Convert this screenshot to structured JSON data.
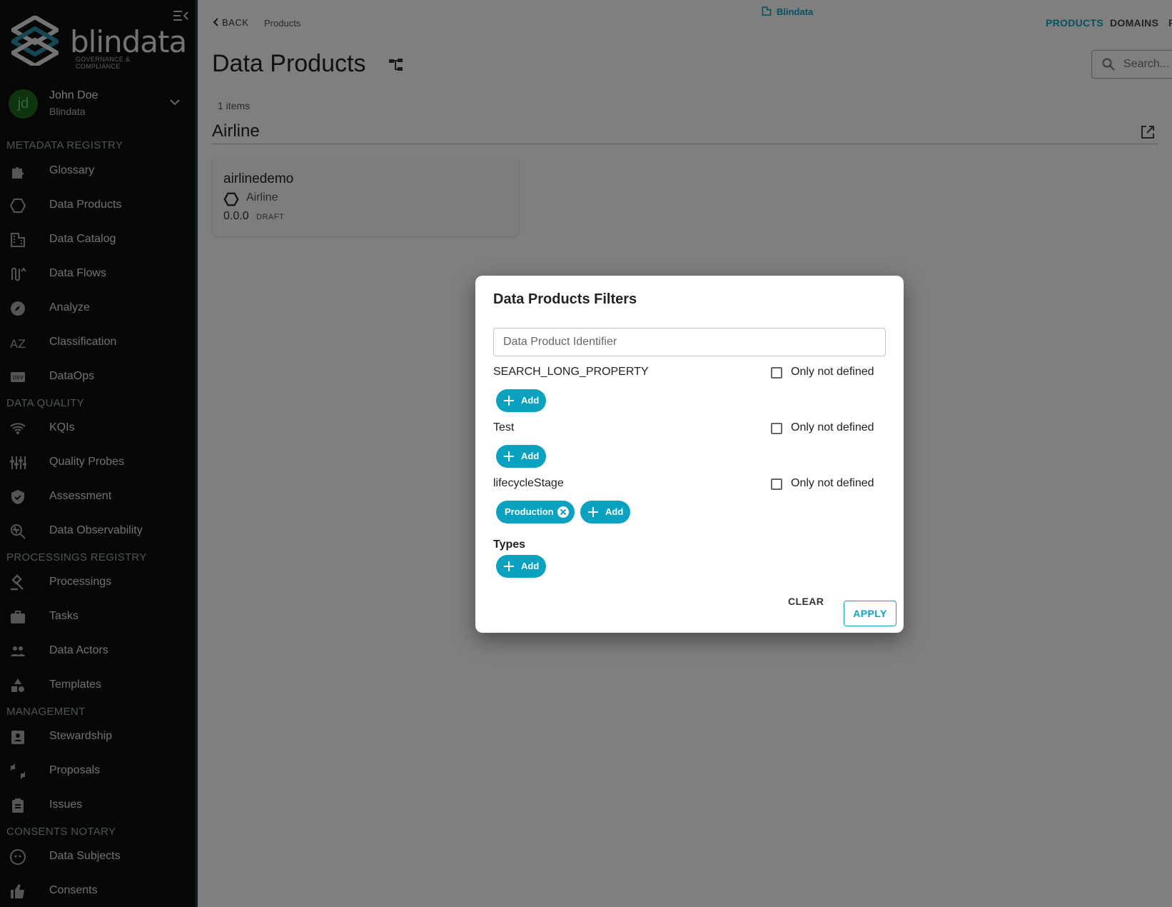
{
  "app": {
    "brand": "blindata",
    "tagline": "GOVERNANCE & COMPLIANCE",
    "accent_color": "#0aa2c0"
  },
  "user": {
    "initials": "jd",
    "name": "John Doe",
    "org": "Blindata"
  },
  "sidebar": {
    "sections": [
      {
        "title": "METADATA REGISTRY",
        "items": [
          {
            "label": "Glossary",
            "icon": "puzzle-icon"
          },
          {
            "label": "Data Products",
            "icon": "hexagon-icon"
          },
          {
            "label": "Data Catalog",
            "icon": "building-icon"
          },
          {
            "label": "Data Flows",
            "icon": "flow-icon"
          },
          {
            "label": "Analyze",
            "icon": "compass-icon"
          },
          {
            "label": "Classification",
            "icon": "az-icon"
          },
          {
            "label": "DataOps",
            "icon": "dev-icon"
          }
        ]
      },
      {
        "title": "DATA QUALITY",
        "items": [
          {
            "label": "KQIs",
            "icon": "wifi-icon"
          },
          {
            "label": "Quality Probes",
            "icon": "sliders-icon"
          },
          {
            "label": "Assessment",
            "icon": "shield-icon"
          },
          {
            "label": "Data Observability",
            "icon": "observe-icon"
          }
        ]
      },
      {
        "title": "PROCESSINGS REGISTRY",
        "items": [
          {
            "label": "Processings",
            "icon": "gavel-icon"
          },
          {
            "label": "Tasks",
            "icon": "briefcase-icon"
          },
          {
            "label": "Data Actors",
            "icon": "people-icon"
          },
          {
            "label": "Templates",
            "icon": "shapes-icon"
          }
        ]
      },
      {
        "title": "MANAGEMENT",
        "items": [
          {
            "label": "Stewardship",
            "icon": "badge-icon"
          },
          {
            "label": "Proposals",
            "icon": "thumbs-icon"
          },
          {
            "label": "Issues",
            "icon": "clipboard-icon"
          }
        ]
      },
      {
        "title": "CONSENTS NOTARY",
        "items": [
          {
            "label": "Data Subjects",
            "icon": "face-icon"
          },
          {
            "label": "Consents",
            "icon": "thumb-up-icon"
          }
        ]
      }
    ]
  },
  "header": {
    "back": "BACK",
    "breadcrumb": "Products",
    "tenant": "Blindata",
    "nav": [
      "PRODUCTS",
      "DOMAINS",
      "F"
    ]
  },
  "main": {
    "title": "Data Products",
    "search_placeholder": "Search...",
    "count": "1 items",
    "group": "Airline",
    "card": {
      "name": "airlinedemo",
      "domain": "Airline",
      "version": "0.0.0",
      "status": "DRAFT"
    }
  },
  "dialog": {
    "title": "Data Products Filters",
    "identifier_placeholder": "Data Product Identifier",
    "properties": [
      {
        "name": "SEARCH_LONG_PROPERTY",
        "only_not_defined": "Only not defined",
        "add": "Add"
      },
      {
        "name": "Test",
        "only_not_defined": "Only not defined",
        "add": "Add"
      },
      {
        "name": "lifecycleStage",
        "only_not_defined": "Only not defined",
        "chip": "Production",
        "add": "Add"
      }
    ],
    "types": {
      "label": "Types",
      "add": "Add"
    },
    "clear": "CLEAR",
    "apply": "APPLY"
  }
}
